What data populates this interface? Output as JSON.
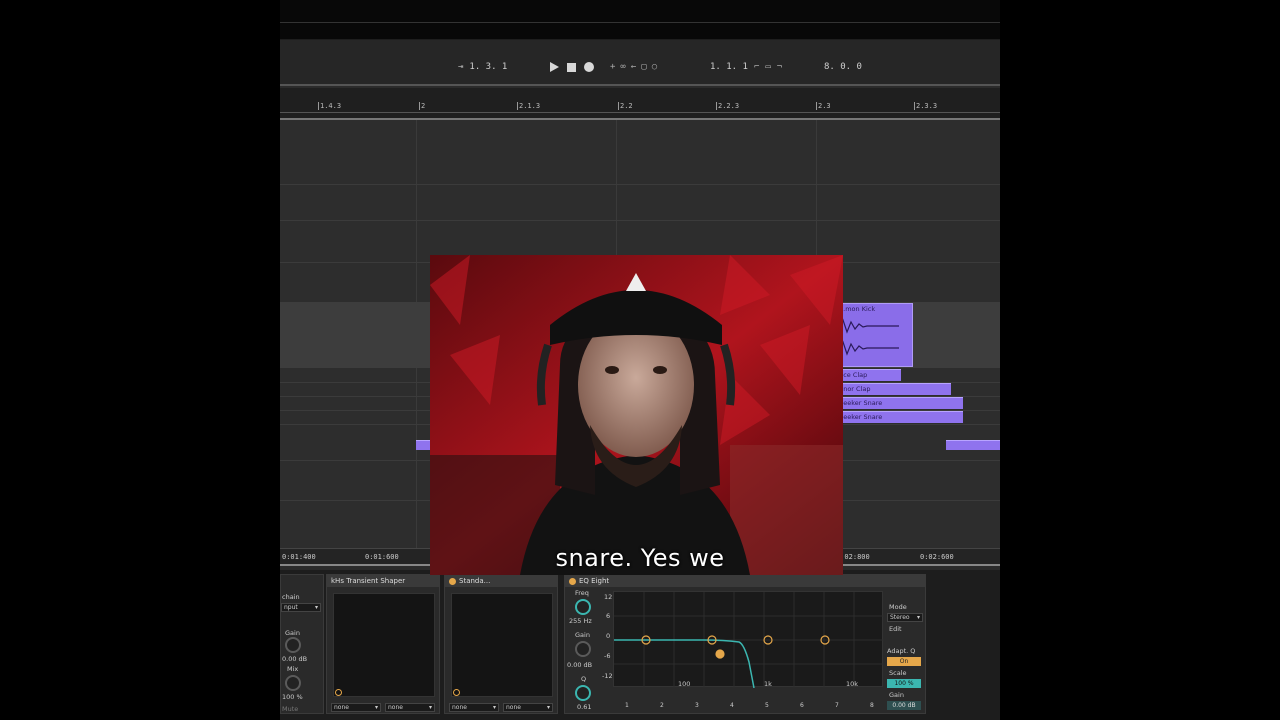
{
  "transport": {
    "arrangement_position": "1.  3.  1",
    "loop_start": "1.  1.  1",
    "loop_length": "8.  0.  0"
  },
  "ruler": {
    "ticks": [
      "1.4.3",
      "2",
      "2.1.3",
      "2.2",
      "2.2.3",
      "2.3",
      "2.3.3"
    ]
  },
  "clips": {
    "kick": "...mon Kick",
    "clap1": "...ce Clap",
    "clap2": "...nor Clap",
    "snare1": "...eeker Snare",
    "snare2": "...eeker Snare"
  },
  "timebar": {
    "t1": "0:01:400",
    "t2": "0:01:600",
    "t3": "0:02:600",
    "t4": "0:02:800"
  },
  "devices": {
    "chain": {
      "title": "",
      "sidechain": "chain",
      "input": "nput",
      "gain_label": "Gain",
      "gain_value": "0.00 dB",
      "mix_label": "Mix",
      "mix_value": "100 %",
      "mute": "Mute"
    },
    "transient": {
      "title": "kHs Transient Shaper",
      "sel1": "none",
      "sel2": "none"
    },
    "standard": {
      "title": "Standa...",
      "sel1": "none",
      "sel2": "none"
    },
    "eq": {
      "title": "EQ Eight",
      "freq_label": "Freq",
      "freq_value": "255 Hz",
      "gain_label": "Gain",
      "gain_value": "0.00 dB",
      "q_label": "Q",
      "q_value": "0.61",
      "db_ticks": [
        "12",
        "6",
        "0",
        "-6",
        "-12"
      ],
      "freq_ticks": [
        "100",
        "1k",
        "10k"
      ],
      "bands": [
        "1",
        "2",
        "3",
        "4",
        "5",
        "6",
        "7",
        "8"
      ],
      "mode_label": "Mode",
      "mode_value": "Stereo",
      "edit_label": "Edit",
      "adapt_label": "Adapt. Q",
      "adapt_value": "On",
      "scale_label": "Scale",
      "scale_value": "100 %",
      "out_gain_label": "Gain",
      "out_gain_value": "0.00 dB"
    }
  },
  "caption": "snare. Yes we",
  "colors": {
    "clip": "#8f73ee",
    "accent_orange": "#e5a74a",
    "eq_curve": "#3bb6b0"
  }
}
